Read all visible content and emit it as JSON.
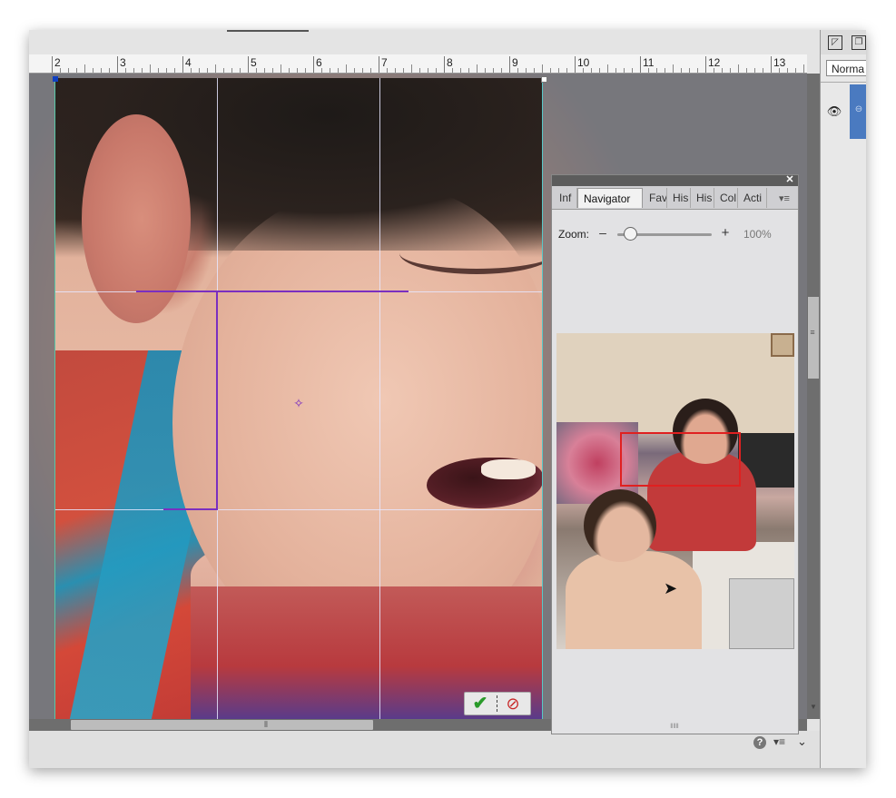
{
  "ruler": {
    "labels": [
      "2",
      "3",
      "4",
      "5",
      "6",
      "7",
      "8",
      "9",
      "10",
      "11",
      "12",
      "13"
    ]
  },
  "canvas": {
    "commit_icon": "checkmark-icon",
    "cancel_icon": "cancel-circle-icon"
  },
  "navigator": {
    "tabs": [
      "Inf",
      "Navigator",
      "Fav",
      "His",
      "His",
      "Col",
      "Acti"
    ],
    "active_tab": "Navigator",
    "zoom_label": "Zoom:",
    "zoom_value": "100%",
    "zoom_percent": 100
  },
  "layers_panel": {
    "blend_mode": "Norma"
  },
  "colors": {
    "crop_grid_accent": "#7a2fc0",
    "navigator_view_rect": "#e02020",
    "layer_selected": "#4a7ac0"
  }
}
